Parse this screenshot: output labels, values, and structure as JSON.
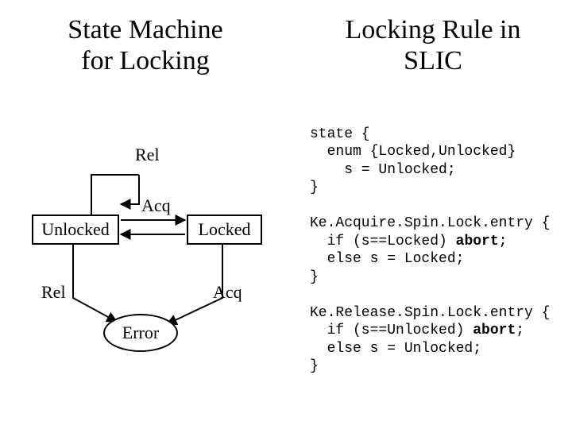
{
  "titles": {
    "left": "State Machine\nfor Locking",
    "right": "Locking Rule in\nSLIC"
  },
  "diagram": {
    "states": {
      "unlocked": "Unlocked",
      "locked": "Locked",
      "error": "Error"
    },
    "edges": {
      "self_rel": "Rel",
      "acq_fwd": "Acq",
      "rel_to_error": "Rel",
      "acq_to_error": "Acq"
    }
  },
  "code": {
    "block1_l1": "state {",
    "block1_l2": "  enum {Locked,Unlocked}",
    "block1_l3": "    s = Unlocked;",
    "block1_l4": "}",
    "block2_l1": "Ke.Acquire.Spin.Lock.entry {",
    "block2_l2a": "  if (s==Locked) ",
    "block2_kw_abort1": "abort",
    "block2_l2b": ";",
    "block2_l3": "  else s = Locked;",
    "block2_l4": "}",
    "block3_l1": "Ke.Release.Spin.Lock.entry {",
    "block3_l2a": "  if (s==Unlocked) ",
    "block3_kw_abort2": "abort",
    "block3_l2b": ";",
    "block3_l3": "  else s = Unlocked;",
    "block3_l4": "}"
  }
}
